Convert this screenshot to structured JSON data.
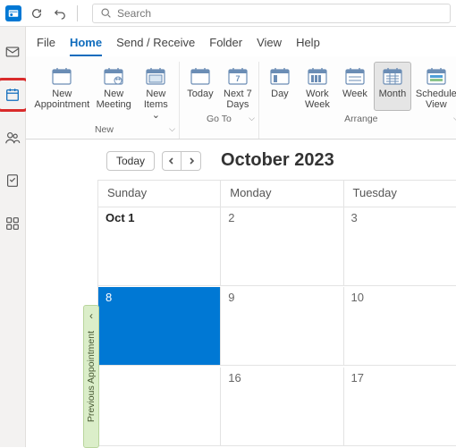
{
  "titlebar": {
    "search_placeholder": "Search"
  },
  "menu": {
    "items": [
      "File",
      "Home",
      "Send / Receive",
      "Folder",
      "View",
      "Help"
    ],
    "active_index": 1
  },
  "ribbon": {
    "groups": [
      {
        "label": "New",
        "buttons": [
          {
            "name": "new-appointment",
            "label": "New\nAppointment",
            "icon": "calendar"
          },
          {
            "name": "new-meeting",
            "label": "New\nMeeting",
            "icon": "meeting"
          },
          {
            "name": "new-items",
            "label": "New\nItems ⌄",
            "icon": "items"
          }
        ]
      },
      {
        "label": "Go To",
        "buttons": [
          {
            "name": "today",
            "label": "Today",
            "icon": "calendar"
          },
          {
            "name": "next-7-days",
            "label": "Next 7\nDays",
            "icon": "week7"
          }
        ]
      },
      {
        "label": "Arrange",
        "buttons": [
          {
            "name": "day-view",
            "label": "Day",
            "icon": "day"
          },
          {
            "name": "work-week-view",
            "label": "Work\nWeek",
            "icon": "workweek"
          },
          {
            "name": "week-view",
            "label": "Week",
            "icon": "week"
          },
          {
            "name": "month-view",
            "label": "Month",
            "icon": "month",
            "pressed": true
          },
          {
            "name": "schedule-view",
            "label": "Schedule\nView",
            "icon": "schedule"
          }
        ]
      }
    ]
  },
  "calendar": {
    "today_label": "Today",
    "title": "October 2023",
    "day_headers": [
      "Sunday",
      "Monday",
      "Tuesday"
    ],
    "prev_appt_label": "Previous Appointment",
    "weeks": [
      {
        "cells": [
          "Oct 1",
          "2",
          "3"
        ],
        "first": true
      },
      {
        "cells": [
          "8",
          "9",
          "10"
        ],
        "selected_col": 0
      },
      {
        "cells": [
          "",
          "16",
          "17"
        ]
      }
    ]
  }
}
